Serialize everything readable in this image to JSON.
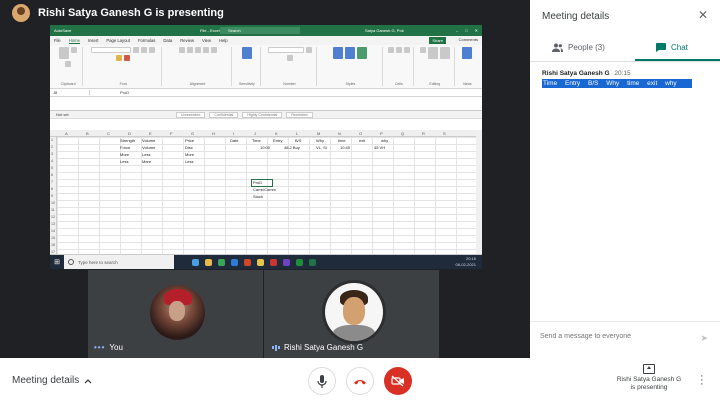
{
  "presenter_banner": "Rishi Satya Ganesh G is presenting",
  "excel": {
    "autosave": "AutoSave",
    "filename": "File - Excel",
    "search": "Search",
    "user": "Satya Ganesh G, Pok",
    "tabs": [
      "File",
      "Home",
      "Insert",
      "Page Layout",
      "Formulas",
      "Data",
      "Review",
      "View",
      "Help"
    ],
    "share": "Share",
    "comments": "Comments",
    "ribbon_groups": [
      "Clipboard",
      "Font",
      "Alignment",
      "Sensitivity",
      "Number",
      "Styles",
      "Cells",
      "Editing",
      "Ideas"
    ],
    "name_box": "J8",
    "formula": "ProD",
    "sensitivity_label": "Not set",
    "sensitivity_options": [
      "Unrestricted",
      "Confidential",
      "Highly Confidential",
      "Restricted"
    ],
    "columns": [
      "A",
      "B",
      "C",
      "D",
      "E",
      "F",
      "G",
      "H",
      "I",
      "J",
      "K",
      "L",
      "M",
      "N",
      "O",
      "P",
      "Q",
      "R",
      "S"
    ],
    "rows": [
      "1",
      "2",
      "3",
      "4",
      "5",
      "6",
      "7",
      "8",
      "9",
      "10",
      "11",
      "12",
      "13",
      "14",
      "15",
      "16",
      "17"
    ],
    "cells": {
      "strength": "Strength",
      "volume_h": "Volume",
      "price_h": "Price",
      "force": "Force",
      "volume1": "Volume",
      "disc": "Disc",
      "more": "More",
      "less1": "Less",
      "more2": "More",
      "less2": "Less",
      "more3": "Mare",
      "less3": "Less",
      "date": "Date",
      "time": "Time",
      "entry": "Entry",
      "bs": "B/S",
      "why": "Why",
      "time2": "time",
      "exit": "exit",
      "why2": "why",
      "t1": "10:00",
      "e1": "48.2 Buy",
      "w1": "VL, SI",
      "t2": "10:45",
      "x1": "45 VH",
      "prod": "ProD",
      "carre": "Carre/Comm",
      "stock": "Stock"
    },
    "sheets": [
      "NTS",
      "Sheet1",
      "All",
      "Surya Hut",
      "BTI Actuals",
      "Sheet2",
      "Notes",
      "Hong Un",
      "Sheet3",
      "Sheet5"
    ],
    "active_sheet": "Sheet5"
  },
  "taskbar": {
    "search": "Type here to search",
    "time": "20:16",
    "date": "06-02-2021"
  },
  "tiles": {
    "you": "You",
    "rishi": "Rishi Satya Ganesh G"
  },
  "panel": {
    "title": "Meeting details",
    "people_tab": "People (3)",
    "chat_tab": "Chat",
    "message": {
      "sender": "Rishi Satya Ganesh G",
      "time": "20:15",
      "text": "Time Entry B/S Why time exit why"
    },
    "input_placeholder": "Send a message to everyone"
  },
  "bottom": {
    "meeting_details": "Meeting details",
    "presenting_line1": "Rishi Satya Ganesh G",
    "presenting_line2": "is presenting"
  },
  "colors": {
    "excel_green": "#217346",
    "chat_accent": "#00796b",
    "hangup_red": "#d93025",
    "highlight_blue": "#1967d2"
  }
}
